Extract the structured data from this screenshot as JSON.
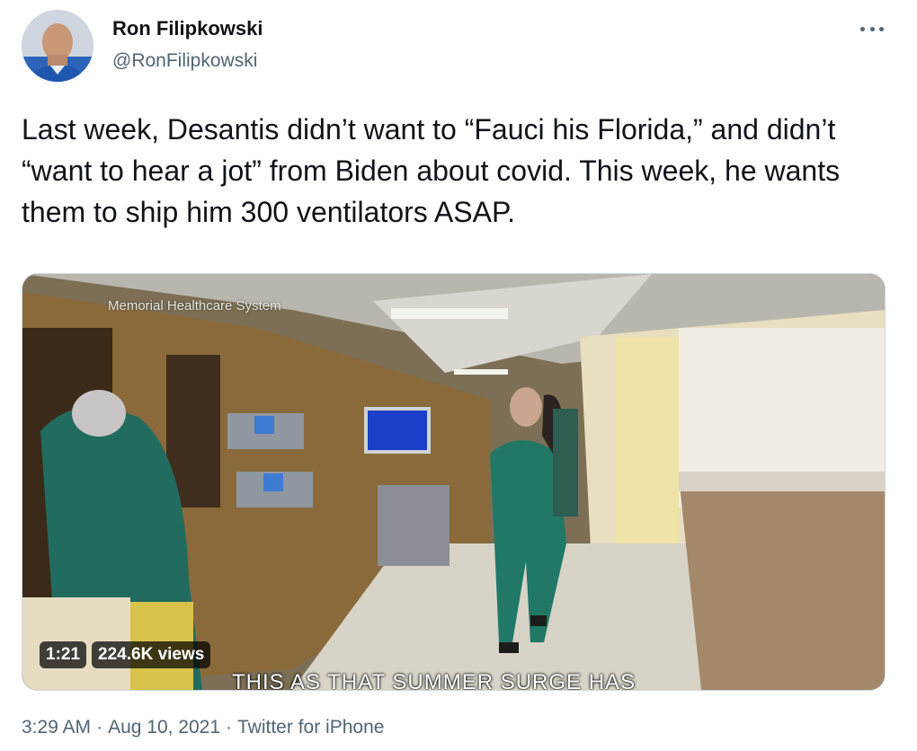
{
  "author": {
    "name": "Ron Filipkowski",
    "handle": "@RonFilipkowski"
  },
  "more_icon": "more-horizontal-icon",
  "tweet": {
    "text": "Last week, Desantis didn’t want to “Fauci his Florida,” and didn’t “want to hear a jot” from Biden about covid. This week, he wants them to ship him 300 ventilators ASAP."
  },
  "video": {
    "watermark": "Memorial Healthcare System",
    "duration": "1:21",
    "views": "224.6K views",
    "caption": "THIS AS THAT SUMMER SURGE HAS"
  },
  "meta": {
    "time": "3:29 AM",
    "date": "Aug 10, 2021",
    "source": "Twitter for iPhone",
    "separator": "·"
  },
  "colors": {
    "text_primary": "#0f1419",
    "text_secondary": "#536471",
    "border": "#cfd9de"
  }
}
